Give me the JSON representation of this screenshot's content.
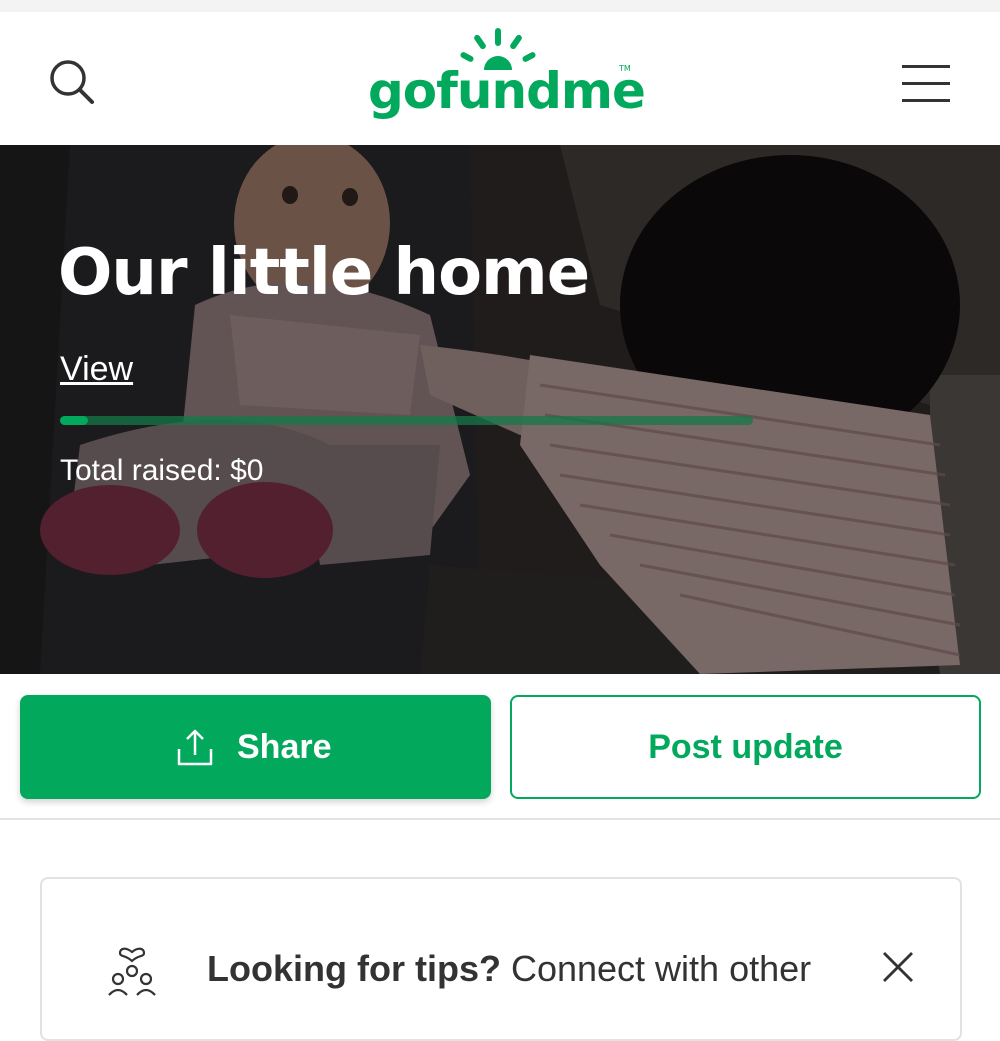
{
  "header": {
    "logo_text": "gofundme",
    "logo_tm": "TM",
    "search_icon": "search-icon",
    "menu_icon": "hamburger-menu-icon",
    "brand_color": "#02a95c"
  },
  "campaign": {
    "title": "Our little home",
    "view_link": "View",
    "progress": 0.04,
    "total_raised": "Total raised: $0"
  },
  "actions": {
    "share_label": "Share",
    "share_icon": "share-upload-icon",
    "post_update_label": "Post update"
  },
  "tips": {
    "heading": "Looking for tips?",
    "body": " Connect with other",
    "icon": "community-heart-icon",
    "close_icon": "close-icon"
  }
}
